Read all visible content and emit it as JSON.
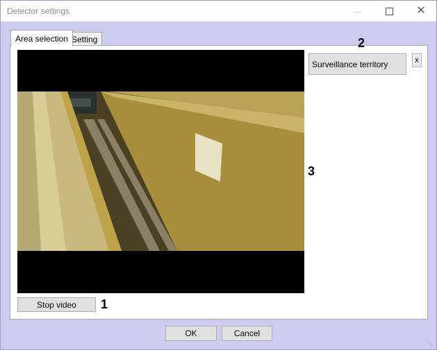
{
  "window": {
    "title": "Detector settings"
  },
  "tabs": [
    {
      "label": "Area selection",
      "active": true
    },
    {
      "label": "Setting",
      "active": false
    }
  ],
  "video": {
    "stop_label": "Stop video"
  },
  "areas": {
    "items": [
      {
        "label": "Surveillance territory"
      }
    ],
    "remove_label": "x"
  },
  "callouts": [
    "1",
    "2",
    "3"
  ],
  "footer": {
    "ok_label": "OK",
    "cancel_label": "Cancel"
  },
  "colors": {
    "window_bg": "#ccccee",
    "panel_bg": "#ffffff",
    "button_bg": "#e1e1e1",
    "video_bg": "#000000"
  }
}
